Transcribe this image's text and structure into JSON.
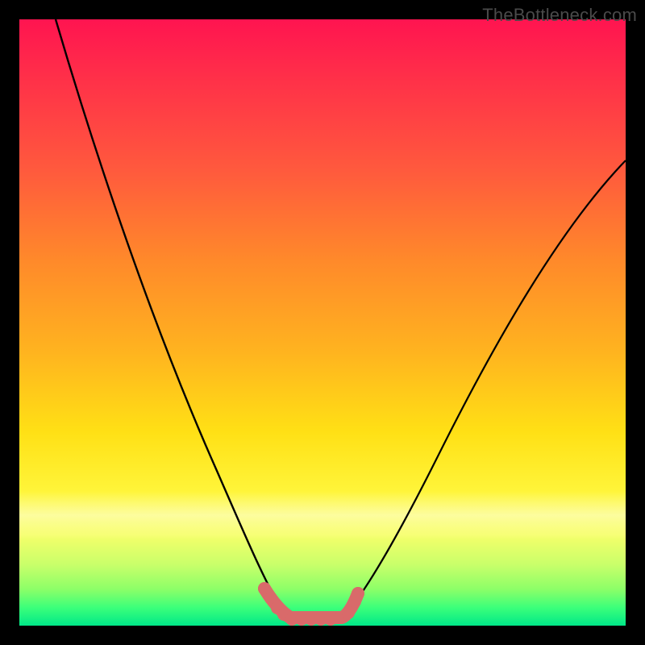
{
  "watermark": "TheBottleneck.com",
  "colors": {
    "curve_stroke": "#000000",
    "marker_stroke": "#d96a6a",
    "marker_fill": "#d96a6a",
    "bg_black": "#000000"
  },
  "chart_data": {
    "type": "line",
    "title": "",
    "xlabel": "",
    "ylabel": "",
    "xlim": [
      0,
      100
    ],
    "ylim": [
      0,
      100
    ],
    "left_curve": [
      {
        "x": 6,
        "y": 100
      },
      {
        "x": 10,
        "y": 88
      },
      {
        "x": 15,
        "y": 74
      },
      {
        "x": 20,
        "y": 60
      },
      {
        "x": 25,
        "y": 47
      },
      {
        "x": 30,
        "y": 34
      },
      {
        "x": 35,
        "y": 21
      },
      {
        "x": 38,
        "y": 12
      },
      {
        "x": 40,
        "y": 6
      },
      {
        "x": 42,
        "y": 2
      },
      {
        "x": 44,
        "y": 0
      }
    ],
    "right_curve": [
      {
        "x": 53,
        "y": 0
      },
      {
        "x": 55,
        "y": 2
      },
      {
        "x": 58,
        "y": 7
      },
      {
        "x": 62,
        "y": 15
      },
      {
        "x": 68,
        "y": 27
      },
      {
        "x": 75,
        "y": 40
      },
      {
        "x": 82,
        "y": 52
      },
      {
        "x": 90,
        "y": 64
      },
      {
        "x": 100,
        "y": 76
      }
    ],
    "flat_segment": [
      {
        "x": 44,
        "y": 0
      },
      {
        "x": 53,
        "y": 0
      }
    ],
    "markers": [
      {
        "x": 40.5,
        "y": 5
      },
      {
        "x": 41.5,
        "y": 3.5
      },
      {
        "x": 42.5,
        "y": 2
      },
      {
        "x": 43.5,
        "y": 1
      },
      {
        "x": 44.5,
        "y": 0
      },
      {
        "x": 46,
        "y": 0
      },
      {
        "x": 47.5,
        "y": 0
      },
      {
        "x": 49,
        "y": 0
      },
      {
        "x": 50.5,
        "y": 0
      },
      {
        "x": 52,
        "y": 0
      },
      {
        "x": 53,
        "y": 1
      },
      {
        "x": 54,
        "y": 2
      },
      {
        "x": 55.5,
        "y": 4.5
      }
    ]
  }
}
